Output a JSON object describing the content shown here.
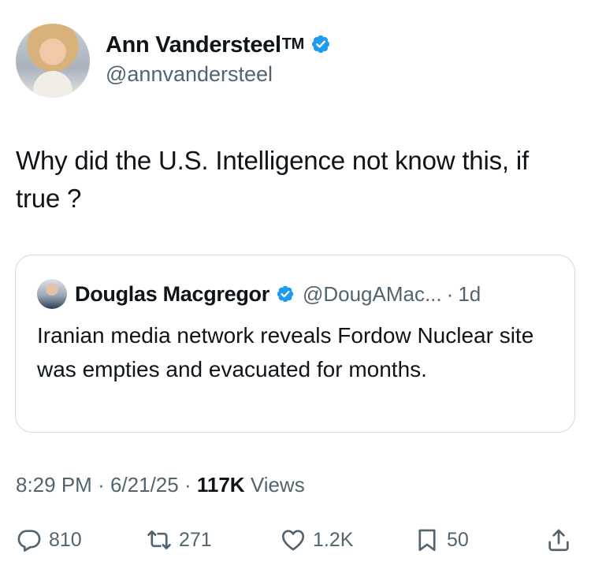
{
  "author": {
    "display_name": "Ann Vandersteel",
    "tm": "TM",
    "handle": "@annvandersteel",
    "verified": true
  },
  "tweet": {
    "text": "Why did the U.S. Intelligence not know this, if true ?"
  },
  "quote": {
    "display_name": "Douglas Macgregor",
    "handle": "@DougAMac...",
    "separator": "·",
    "time": "1d",
    "text": "Iranian media network reveals Fordow Nuclear site was empties and evacuated for months."
  },
  "meta": {
    "time": "8:29 PM",
    "sep1": "·",
    "date": "6/21/25",
    "sep2": "·",
    "views_count": "117K",
    "views_label": "Views"
  },
  "actions": {
    "replies": "810",
    "reposts": "271",
    "likes": "1.2K",
    "bookmarks": "50"
  },
  "icons": {
    "verified": "verified-badge-icon",
    "reply": "speech-bubble-icon",
    "repost": "repost-arrows-icon",
    "like": "heart-icon",
    "bookmark": "bookmark-icon",
    "share": "share-upload-icon"
  },
  "colors": {
    "verified_blue": "#1d9bf0",
    "text": "#0f1419",
    "secondary": "#536471",
    "border": "#cfd9de"
  }
}
